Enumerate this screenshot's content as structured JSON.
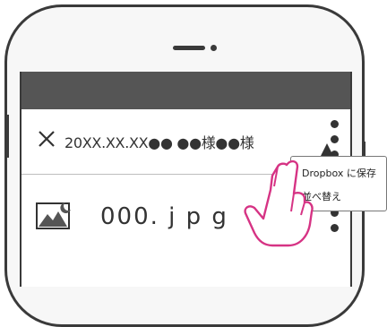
{
  "title": {
    "close_icon": "close-icon",
    "text": "20XX.XX.XX●● ●●様●●様"
  },
  "file": {
    "icon": "image-icon",
    "name": "000. j p g"
  },
  "menu": {
    "items": [
      {
        "label": "Dropbox に保存"
      },
      {
        "label": "並べ替え"
      }
    ]
  },
  "colors": {
    "header_bg": "#555555",
    "hand_outline": "#d63384",
    "text": "#333333"
  }
}
